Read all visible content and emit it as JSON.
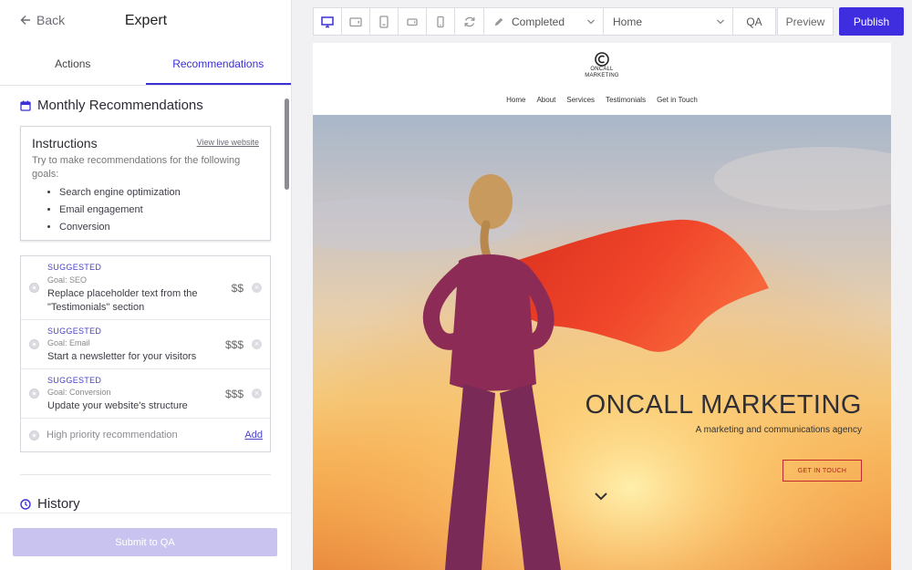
{
  "header": {
    "back_label": "Back",
    "title": "Expert"
  },
  "tabs": [
    {
      "label": "Actions"
    },
    {
      "label": "Recommendations"
    }
  ],
  "monthly": {
    "title": "Monthly Recommendations"
  },
  "instructions": {
    "title": "Instructions",
    "link": "View live website",
    "text": "Try to make recommendations for the following goals:",
    "goals": [
      "Search engine optimization",
      "Email engagement",
      "Conversion"
    ]
  },
  "recommendations": [
    {
      "tag": "SUGGESTED",
      "goal": "Goal: SEO",
      "text": "Replace placeholder text from the \"Testimonials\" section",
      "price": "$$"
    },
    {
      "tag": "SUGGESTED",
      "goal": "Goal: Email",
      "text": "Start a newsletter for your visitors",
      "price": "$$$"
    },
    {
      "tag": "SUGGESTED",
      "goal": "Goal: Conversion",
      "text": "Update your website's structure",
      "price": "$$$"
    }
  ],
  "new_rec": {
    "placeholder": "High priority recommendation",
    "add_label": "Add"
  },
  "history": {
    "title": "History"
  },
  "submit": {
    "label": "Submit to QA"
  },
  "toolbar": {
    "status": "Completed",
    "page": "Home",
    "qa_label": "QA",
    "preview_label": "Preview",
    "publish_label": "Publish"
  },
  "site": {
    "logo_line1": "ONCALL",
    "logo_line2": "MARKETING",
    "nav": [
      "Home",
      "About",
      "Services",
      "Testimonials",
      "Get in Touch"
    ],
    "hero_title": "ONCALL MARKETING",
    "hero_subtitle": "A marketing and communications agency",
    "hero_cta": "GET IN TOUCH"
  },
  "colors": {
    "accent": "#3f2de0",
    "submit_disabled": "#c9c4ef",
    "cta_red": "#c22a2a"
  }
}
